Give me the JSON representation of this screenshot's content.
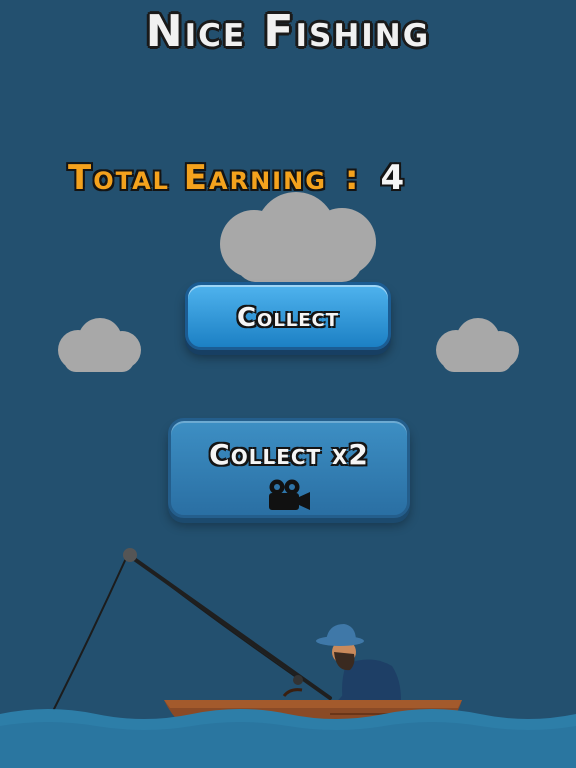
{
  "title": "Nice Fishing",
  "earning": {
    "label": "Total Earning",
    "colon": ":",
    "value": "4"
  },
  "buttons": {
    "collect": "Collect",
    "collect_x2": "Collect x2"
  },
  "icons": {
    "video": "video-camera-icon"
  },
  "colors": {
    "background": "#23506f",
    "accent": "#f4a21d",
    "button": "#2b8fd6",
    "water": "#2d7ea8"
  }
}
